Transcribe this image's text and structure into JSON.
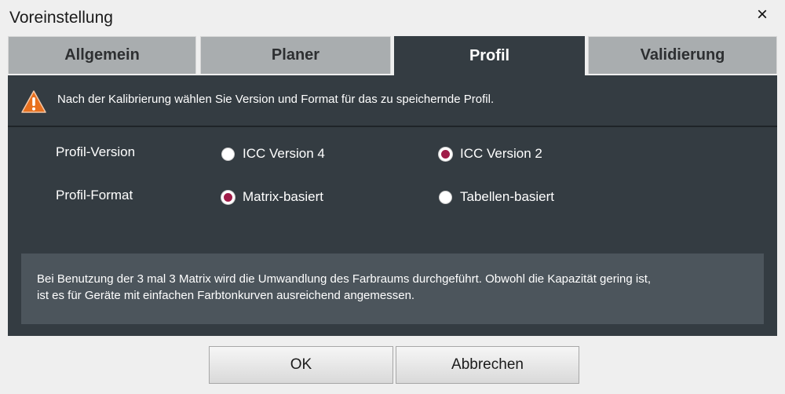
{
  "window": {
    "title": "Voreinstellung",
    "close_icon": "×"
  },
  "tabs": [
    {
      "label": "Allgemein",
      "active": false
    },
    {
      "label": "Planer",
      "active": false
    },
    {
      "label": "Profil",
      "active": true
    },
    {
      "label": "Validierung",
      "active": false
    }
  ],
  "warning": {
    "icon": "warning-icon",
    "text": "Nach der Kalibrierung wählen Sie Version und Format für das zu speichernde Profil."
  },
  "settings": {
    "version": {
      "label": "Profil-Version",
      "options": [
        {
          "label": "ICC Version 4",
          "selected": false
        },
        {
          "label": "ICC Version 2",
          "selected": true
        }
      ]
    },
    "format": {
      "label": "Profil-Format",
      "options": [
        {
          "label": "Matrix-basiert",
          "selected": true
        },
        {
          "label": "Tabellen-basiert",
          "selected": false
        }
      ]
    }
  },
  "description": {
    "line1": "Bei Benutzung der 3 mal 3 Matrix wird die Umwandlung des Farbraums durchgeführt. Obwohl die Kapazität gering ist,",
    "line2": "ist es für Geräte mit einfachen Farbtonkurven ausreichend angemessen."
  },
  "buttons": {
    "ok": "OK",
    "cancel": "Abbrechen"
  },
  "colors": {
    "panel": "#343c42",
    "tab_inactive": "#a9adaf",
    "radio_selected": "#a01c48",
    "warning_orange": "#e8701e"
  }
}
